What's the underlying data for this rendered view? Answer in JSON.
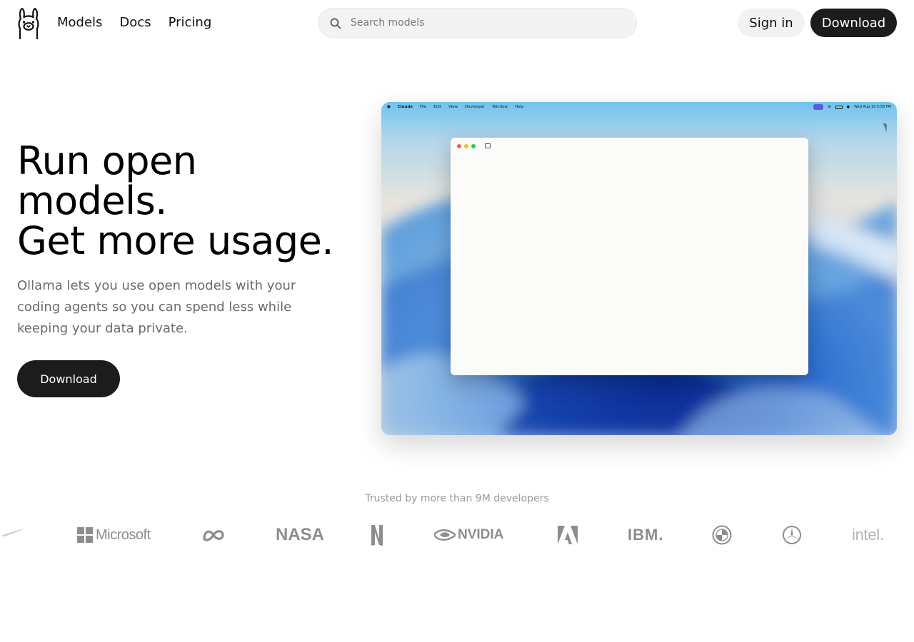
{
  "header": {
    "nav": [
      "Models",
      "Docs",
      "Pricing"
    ],
    "search_placeholder": "Search models",
    "signin_label": "Sign in",
    "download_label": "Download"
  },
  "hero": {
    "title_lines": [
      "Run open",
      "models.",
      "Get more usage."
    ],
    "subtitle": "Ollama lets you use open models with your coding agents so you can spend less while keeping your data private.",
    "download_label": "Download"
  },
  "screenshot": {
    "menubar": {
      "app": "Claude",
      "items": [
        "File",
        "Edit",
        "View",
        "Developer",
        "Window",
        "Help"
      ],
      "clock": "Wed Aug 19  5:58 PM"
    }
  },
  "trusted": {
    "text": "Trusted by more than 9M developers",
    "brands": {
      "microsoft": "Microsoft",
      "nasa": "NASA",
      "nvidia": "NVIDIA",
      "ibm": "IBM.",
      "intel": "intel."
    }
  },
  "colors": {
    "primary_button": "#1c1c1c",
    "secondary_button": "#f2f2f2",
    "muted_text": "#6b6b6b",
    "logo_gray": "#8d8d8d"
  }
}
